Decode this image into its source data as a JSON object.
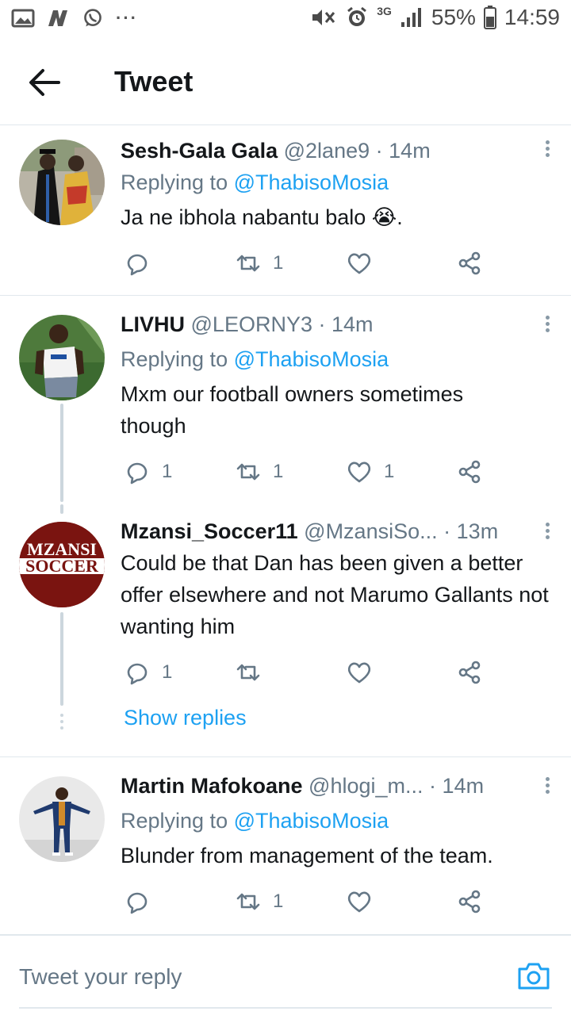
{
  "status_bar": {
    "network": "3G",
    "battery": "55%",
    "time": "14:59",
    "notification_icons": [
      "image-icon",
      "news-icon",
      "whatsapp-icon"
    ],
    "system_icons": [
      "mute-vibrate-icon",
      "alarm-icon",
      "signal-icon",
      "battery-icon"
    ]
  },
  "header": {
    "title": "Tweet",
    "back_icon": "arrow-left-icon"
  },
  "colors": {
    "accent": "#1da1f2",
    "muted": "#657786",
    "text": "#14171a",
    "divider": "#e1e8ed",
    "retweet_icon": "#8899a6"
  },
  "tweets": [
    {
      "name": "Sesh-Gala Gala",
      "handle": "@2lane9",
      "dot": "·",
      "time": "14m",
      "replying_label": "Replying to",
      "replying_to": "@ThabisoMosia",
      "text": "Ja ne ibhola nabantu balo 😭.",
      "replies": "",
      "retweets": "1",
      "likes": ""
    },
    {
      "name": "LIVHU",
      "handle": "@LEORNY3",
      "dot": "·",
      "time": "14m",
      "replying_label": "Replying to",
      "replying_to": "@ThabisoMosia",
      "text": "Mxm our football owners sometimes though",
      "replies": "1",
      "retweets": "1",
      "likes": "1"
    },
    {
      "name": "Mzansi_Soccer11",
      "handle": "@MzansiSo...",
      "dot": "·",
      "time": "13m",
      "avatar_text_1": "MZANSI",
      "avatar_text_2": "SOCCER",
      "text": "Could be that Dan has been given a better offer elsewhere and not Marumo Gallants not wanting him",
      "replies": "1",
      "retweets": "",
      "likes": ""
    },
    {
      "name": "Martin Mafokoane",
      "handle": "@hlogi_m...",
      "dot": "·",
      "time": "14m",
      "replying_label": "Replying to",
      "replying_to": "@ThabisoMosia",
      "text": "Blunder from management of the team.",
      "replies": "",
      "retweets": "1",
      "likes": ""
    }
  ],
  "show_replies": "Show replies",
  "compose": {
    "placeholder": "Tweet your reply",
    "camera_icon": "camera-icon"
  }
}
